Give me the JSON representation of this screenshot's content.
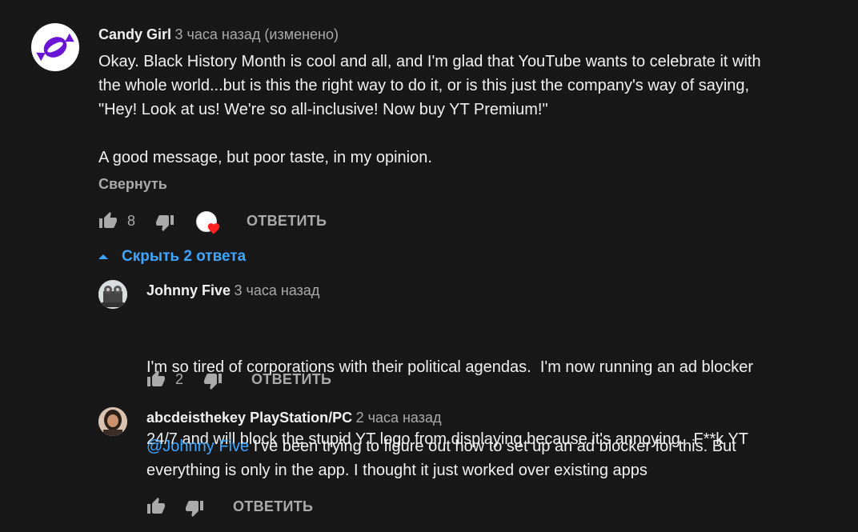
{
  "comment": {
    "author": "Candy Girl",
    "time": "3 часа назад (изменено)",
    "lines": [
      "Okay. Black History Month is cool and all, and I'm glad that YouTube wants to celebrate it with",
      "the whole world...but is this the right way to do it, or is this just the company's way of saying,",
      "\"Hey! Look at us! We're so all-inclusive! Now buy YT Premium!\"",
      "A good message, but poor taste, in my opinion."
    ],
    "collapse_label": "Свернуть",
    "likes": "8",
    "reply_label": "ОТВЕТИТЬ",
    "hide_replies_label": "Скрыть 2 ответа"
  },
  "replies": [
    {
      "author": "Johnny Five",
      "time": "3 часа назад",
      "lines": [
        "I'm so tired of corporations with their political agendas.  I'm now running an ad blocker",
        "24/7 and will block the stupid YT logo from displaying because it's annoying.  F**k YT"
      ],
      "likes": "2",
      "reply_label": "ОТВЕТИТЬ"
    },
    {
      "author": "abcdeisthekey PlayStation/PC",
      "time": "2 часа назад",
      "mention": "@Johnny Five",
      "line1_rest": " I've been trying to figure out how to set up an ad blocker for this. But",
      "line2": "everything is only in the app. I thought it just worked over existing apps",
      "likes": "",
      "reply_label": "ОТВЕТИТЬ"
    }
  ],
  "colors": {
    "background": "#181818",
    "text": "#f1f1f1",
    "secondary": "#aaaaaa",
    "link": "#3ea6ff",
    "avatar_purple": "#6a14d6",
    "heart": "#ff2020"
  },
  "icons": [
    "thumb-up-icon",
    "thumb-down-icon",
    "heart-icon",
    "chevron-up-icon"
  ]
}
